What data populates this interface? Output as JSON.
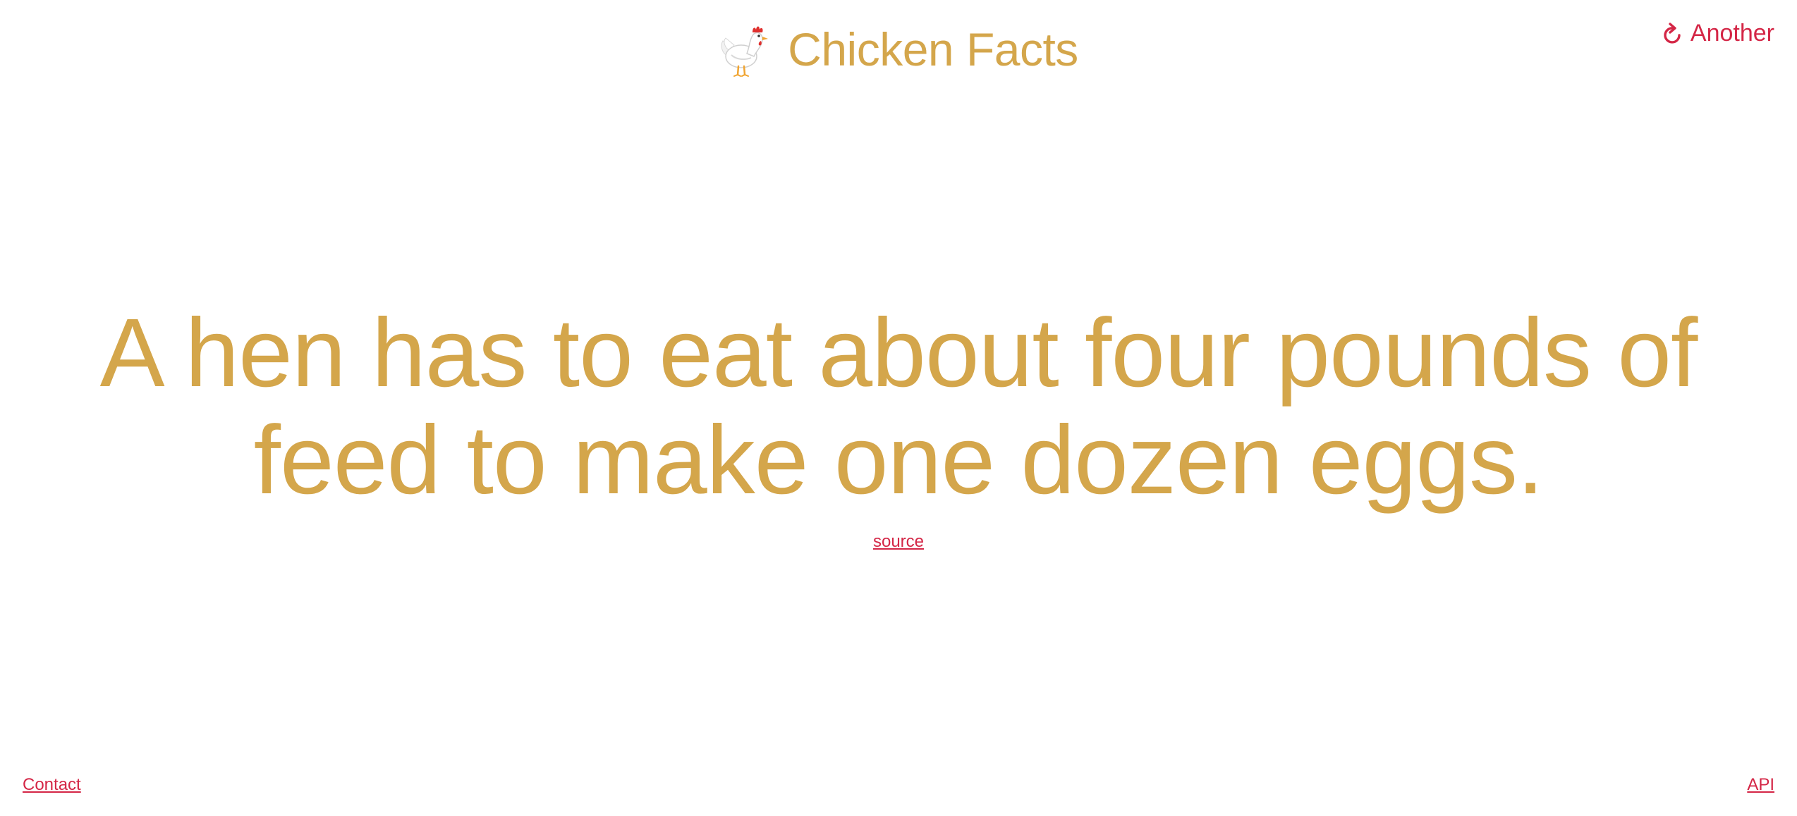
{
  "header": {
    "title": "Chicken Facts",
    "logo_icon": "chicken-icon"
  },
  "actions": {
    "another_label": "Another",
    "another_icon": "refresh-icon"
  },
  "fact": {
    "text": "A hen has to eat about four pounds of feed to make one dozen eggs.",
    "source_label": "source"
  },
  "footer": {
    "contact_label": "Contact",
    "api_label": "API"
  },
  "colors": {
    "title_gold": "#d4a64b",
    "link_red": "#d42646",
    "background": "#ffffff"
  }
}
